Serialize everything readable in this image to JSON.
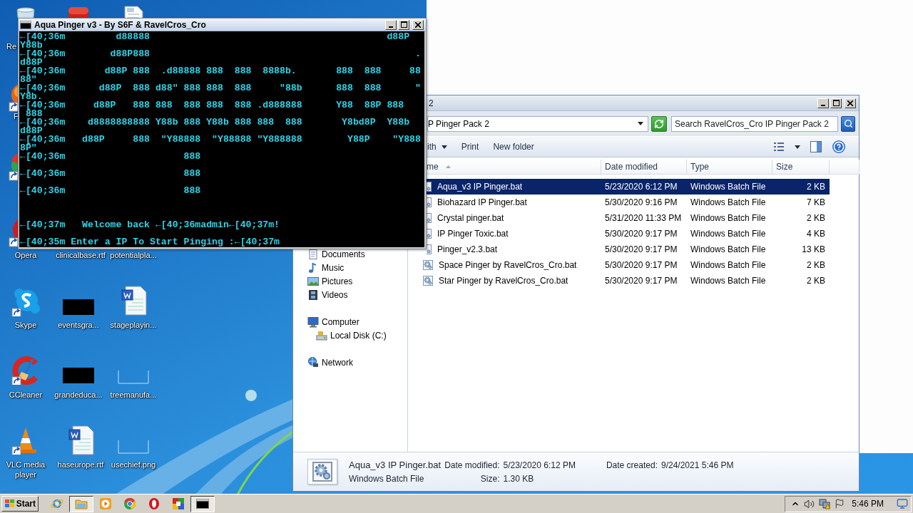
{
  "desktop": {
    "icons": [
      {
        "kind": "recycle",
        "label": "Re"
      },
      {
        "kind": "app"
      },
      {
        "kind": "document"
      },
      {
        "kind": "sliver-orange",
        "label": "F"
      },
      {
        "kind": "sliver-tricolor"
      },
      {
        "kind": "sliver-red",
        "label": "Opera"
      },
      {
        "label": "clinicalbase.rtf"
      },
      {
        "label": "potentialpla..."
      },
      {
        "kind": "chat",
        "label": "Skype"
      },
      {
        "kind": "black",
        "label": "eventsgra..."
      },
      {
        "kind": "word",
        "label": "stageplayin..."
      },
      {
        "kind": "cleaner",
        "label": "CCleaner"
      },
      {
        "kind": "black",
        "label": "grandeduca..."
      },
      {
        "kind": "frame",
        "label": "treemanufa..."
      },
      {
        "kind": "cone",
        "label": "VLC media player"
      },
      {
        "kind": "word",
        "label": "haseurope.rtf"
      },
      {
        "kind": "frame",
        "label": "usechief.png"
      }
    ]
  },
  "explorer": {
    "title": "2",
    "address": "P Pinger Pack 2",
    "search": {
      "placeholder": "Search RavelCros_Cro IP Pinger Pack 2"
    },
    "toolbar": [
      {
        "label": "ith",
        "kind": "menu"
      },
      {
        "label": "Print",
        "kind": "button"
      },
      {
        "label": "New folder",
        "kind": "button"
      }
    ],
    "columns": [
      {
        "label": "me",
        "sorted": true
      },
      {
        "label": "Date modified",
        "sorted": false
      },
      {
        "label": "Type",
        "sorted": false
      },
      {
        "label": "Size",
        "sorted": false
      }
    ],
    "nav_pane": [
      {
        "children": [
          {
            "label": "Documents",
            "kind": "documents"
          },
          {
            "label": "Music",
            "kind": "music"
          },
          {
            "label": "Pictures",
            "kind": "pictures"
          },
          {
            "label": "Videos",
            "kind": "videos"
          }
        ]
      },
      {
        "label": "Computer",
        "kind": "computer",
        "children": [
          {
            "label": "Local Disk (C:)",
            "kind": "disk"
          }
        ]
      },
      {
        "label": "Network",
        "kind": "network"
      }
    ],
    "files": [
      {
        "name": "Aqua_v3 IP Pinger.bat",
        "date": "5/23/2020 6:12 PM",
        "type": "Windows Batch File",
        "size": "2 KB",
        "selected": true
      },
      {
        "name": "Biohazard IP Pinger.bat",
        "date": "5/30/2020 9:16 PM",
        "type": "Windows Batch File",
        "size": "7 KB",
        "selected": false
      },
      {
        "name": "Crystal pinger.bat",
        "date": "5/31/2020 11:33 PM",
        "type": "Windows Batch File",
        "size": "2 KB",
        "selected": false
      },
      {
        "name": "IP Pinger Toxic.bat",
        "date": "5/30/2020 9:17 PM",
        "type": "Windows Batch File",
        "size": "4 KB",
        "selected": false
      },
      {
        "name": "Pinger_v2.3.bat",
        "date": "5/30/2020 9:17 PM",
        "type": "Windows Batch File",
        "size": "13 KB",
        "selected": false
      },
      {
        "name": "Space Pinger by RavelCros_Cro.bat",
        "date": "5/30/2020 9:17 PM",
        "type": "Windows Batch File",
        "size": "2 KB",
        "selected": false
      },
      {
        "name": "Star Pinger by RavelCros_Cro.bat",
        "date": "5/30/2020 9:17 PM",
        "type": "Windows Batch File",
        "size": "2 KB",
        "selected": false
      }
    ],
    "details": {
      "name": "Aqua_v3 IP Pinger.bat",
      "type": "Windows Batch File",
      "properties": [
        {
          "label": "Date modified:",
          "value": "5/23/2020 6:12 PM"
        },
        {
          "label": "Size:",
          "value": "1.30 KB"
        },
        {
          "label": "Date created:",
          "value": "9/24/2021 5:46 PM"
        }
      ]
    }
  },
  "console": {
    "title": "Aqua Pinger v3 - By S6F & RavelCros_Cro",
    "lines": [
      {
        "kind": "text",
        "text": "←[40;36m         d88888                                          d88P"
      },
      {
        "kind": "text",
        "text": "Y88b"
      },
      {
        "kind": "text",
        "text": "←[40;36m        d88P888                                               ."
      },
      {
        "kind": "text",
        "text": "d88P"
      },
      {
        "kind": "text",
        "text": "←[40;36m       d88P 888  .d88888 888  888  8888b.       888  888     88"
      },
      {
        "kind": "text",
        "text": "88\""
      },
      {
        "kind": "text",
        "text": "←[40;36m      d88P  888 d88\" 888 888  888     \"88b      888  888      \""
      },
      {
        "kind": "text",
        "text": "Y8b."
      },
      {
        "kind": "text",
        "text": "←[40;36m     d88P   888 888  888 888  888 .d888888      Y88  88P 888"
      },
      {
        "kind": "text",
        "text": " 888"
      },
      {
        "kind": "text",
        "text": "←[40;36m    d8888888888 Y88b 888 Y88b 888 888  888       Y8bd8P  Y88b"
      },
      {
        "kind": "text",
        "text": "d88P"
      },
      {
        "kind": "text",
        "text": "←[40;36m   d88P     888  \"Y88888  \"Y88888 \"Y888888        Y88P    \"Y888"
      },
      {
        "kind": "text",
        "text": "8P\""
      },
      {
        "kind": "text",
        "text": "←[40;36m                     888"
      },
      {
        "kind": "blank"
      },
      {
        "kind": "text",
        "text": "←[40;36m                     888"
      },
      {
        "kind": "blank"
      },
      {
        "kind": "text",
        "text": "←[40;36m                     888"
      },
      {
        "kind": "blank"
      },
      {
        "kind": "blank"
      },
      {
        "kind": "blank"
      },
      {
        "kind": "text",
        "text": "←[40;37m   Welcome back ←[40;36madmin←[40;37m!"
      },
      {
        "kind": "blank"
      },
      {
        "kind": "text",
        "text": "←[40;35m Enter a IP To Start Pinging :←[40;37m"
      }
    ]
  },
  "taskbar": {
    "start": "Start",
    "buttons": [
      {
        "kind": "globe",
        "selected": false
      },
      {
        "kind": "folder",
        "selected": true
      },
      {
        "kind": "play",
        "selected": false
      },
      {
        "kind": "tricolor",
        "selected": false
      },
      {
        "kind": "ring",
        "selected": false
      },
      {
        "kind": "grid",
        "selected": false
      },
      {
        "kind": "terminal",
        "selected": true
      }
    ],
    "clock": "5:46 PM"
  }
}
